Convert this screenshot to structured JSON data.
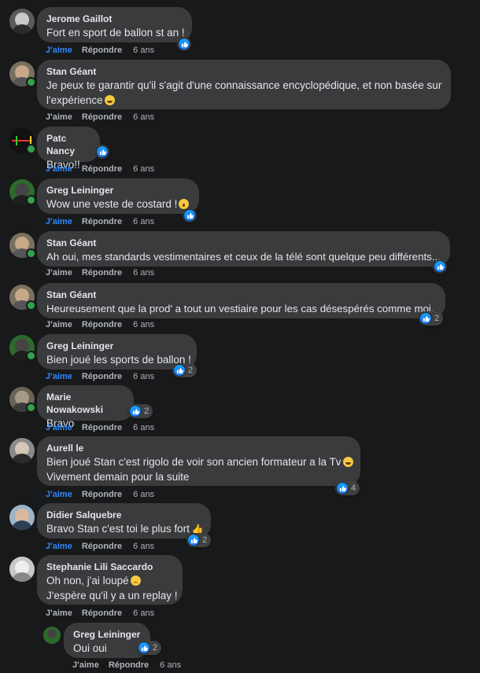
{
  "actions": {
    "like": "J'aime",
    "reply": "Répondre"
  },
  "comments": [
    {
      "author": "Jerome Gaillot",
      "lines": [
        "Fort en sport de ballon st an !"
      ],
      "time": "6 ans",
      "liked": true,
      "reaction_count": ""
    },
    {
      "author": "Stan Géant",
      "lines": [
        "Je peux te garantir qu'il s'agit d'une connaissance encyclopédique, et non basée sur",
        "l'expérience"
      ],
      "emoji": "grin",
      "time": "6 ans",
      "liked": false,
      "reaction_count": ""
    },
    {
      "author": "Patc Nancy",
      "lines": [
        "Bravo!!"
      ],
      "time": "6 ans",
      "liked": true,
      "reaction_count": ""
    },
    {
      "author": "Greg Leininger",
      "lines": [
        "Wow une veste de costard !"
      ],
      "emoji": "wow",
      "time": "6 ans",
      "liked": true,
      "reaction_count": ""
    },
    {
      "author": "Stan Géant",
      "lines": [
        "Ah oui, mes standards vestimentaires et ceux de la télé sont quelque peu différents..."
      ],
      "time": "6 ans",
      "liked": false,
      "reaction_count": ""
    },
    {
      "author": "Stan Géant",
      "lines": [
        "Heureusement que la prod' a tout un vestiaire pour les cas désespérés comme moi."
      ],
      "time": "6 ans",
      "liked": false,
      "reaction_count": "2"
    },
    {
      "author": "Greg Leininger",
      "lines": [
        "Bien joué les sports de ballon !"
      ],
      "time": "6 ans",
      "liked": true,
      "reaction_count": "2"
    },
    {
      "author": "Marie Nowakowski",
      "lines": [
        "Bravo"
      ],
      "time": "6 ans",
      "liked": true,
      "reaction_count": "2"
    },
    {
      "author": "Aurell le",
      "lines": [
        "Bien joué Stan c'est rigolo de voir son ancien formateur a la Tv",
        "Vivement demain pour la suite"
      ],
      "emoji": "grin",
      "time": "6 ans",
      "liked": true,
      "reaction_count": "4"
    },
    {
      "author": "Didier Salquebre",
      "lines": [
        "Bravo Stan c'est toi le plus fort"
      ],
      "emoji": "thumb",
      "time": "6 ans",
      "liked": true,
      "reaction_count": "2"
    },
    {
      "author": "Stephanie Lili Saccardo",
      "lines": [
        "Oh non, j'ai loupé",
        "J'espère qu'il y a un replay !"
      ],
      "emoji": "sad",
      "time": "6 ans",
      "liked": false,
      "reaction_count": ""
    },
    {
      "author": "Greg Leininger",
      "lines": [
        "Oui oui"
      ],
      "time": "6 ans",
      "liked": false,
      "reaction_count": "2"
    }
  ],
  "colors": {
    "like_active": "#2d88ff",
    "bubble": "#3a3b3c",
    "background": "#18191a",
    "online": "#31a24c"
  }
}
